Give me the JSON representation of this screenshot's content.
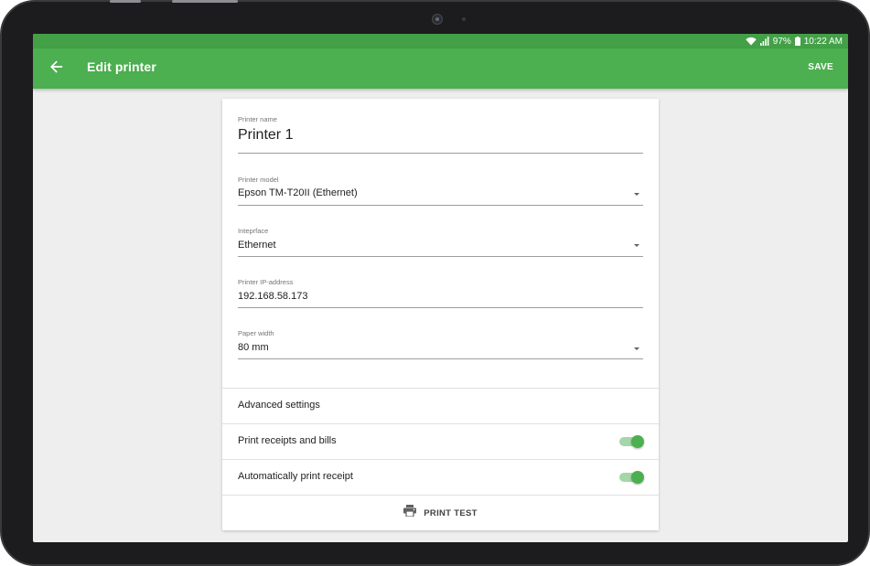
{
  "status_bar": {
    "battery": "97%",
    "time": "10:22 AM",
    "icons": [
      "wifi-icon",
      "signal-icon",
      "battery-icon"
    ]
  },
  "app_bar": {
    "back_icon": "arrow-back-icon",
    "title": "Edit printer",
    "save_label": "SAVE"
  },
  "form": {
    "printer_name": {
      "label": "Printer name",
      "value": "Printer 1"
    },
    "printer_model": {
      "label": "Printer model",
      "value": "Epson TM-T20II (Ethernet)"
    },
    "interface": {
      "label": "Inteprface",
      "value": "Ethernet"
    },
    "ip_address": {
      "label": "Printer IP-address",
      "value": "192.168.58.173"
    },
    "paper_width": {
      "label": "Paper width",
      "value": "80 mm"
    }
  },
  "settings": {
    "advanced_label": "Advanced settings",
    "print_receipts": {
      "label": "Print receipts and bills",
      "enabled": true
    },
    "auto_print": {
      "label": "Automatically print receipt",
      "enabled": true
    }
  },
  "actions": {
    "print_icon": "printer-icon",
    "print_test_label": "PRINT TEST"
  },
  "colors": {
    "primary": "#4caf50",
    "primary_dark": "#43a047",
    "toggle_track": "#a5d6a7",
    "background": "#eeeeee"
  }
}
